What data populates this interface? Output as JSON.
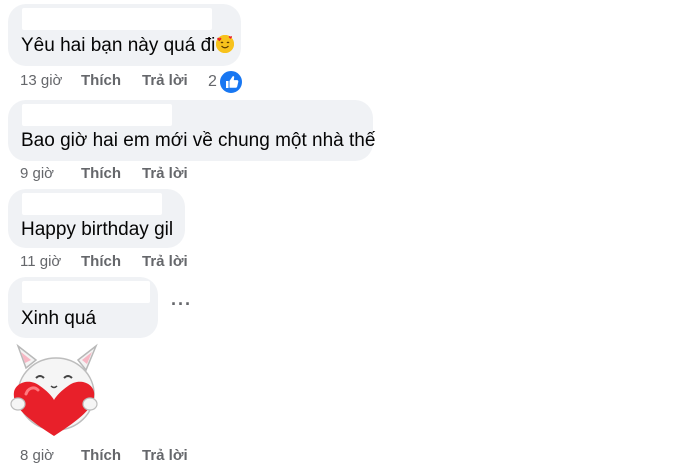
{
  "comments": [
    {
      "text": "Yêu hai bạn này quá đi",
      "time": "13 giờ",
      "like": "Thích",
      "reply": "Trả lời",
      "reaction_count": "2",
      "emoji": "smiling-face-with-hearts-icon"
    },
    {
      "text": "Bao giờ hai em mới về chung một nhà thế",
      "time": "9 giờ",
      "like": "Thích",
      "reply": "Trả lời"
    },
    {
      "text": "Happy birthday gil",
      "time": "11 giờ",
      "like": "Thích",
      "reply": "Trả lời"
    },
    {
      "text": "Xinh quá",
      "time": "8 giờ",
      "like": "Thích",
      "reply": "Trả lời",
      "more": "···",
      "sticker": "bunny-hugging-heart-sticker"
    }
  ],
  "colors": {
    "bubble": "#f0f2f5",
    "meta_text": "#65676b",
    "like_badge": "#1877f2",
    "heart": "#e8202a"
  }
}
